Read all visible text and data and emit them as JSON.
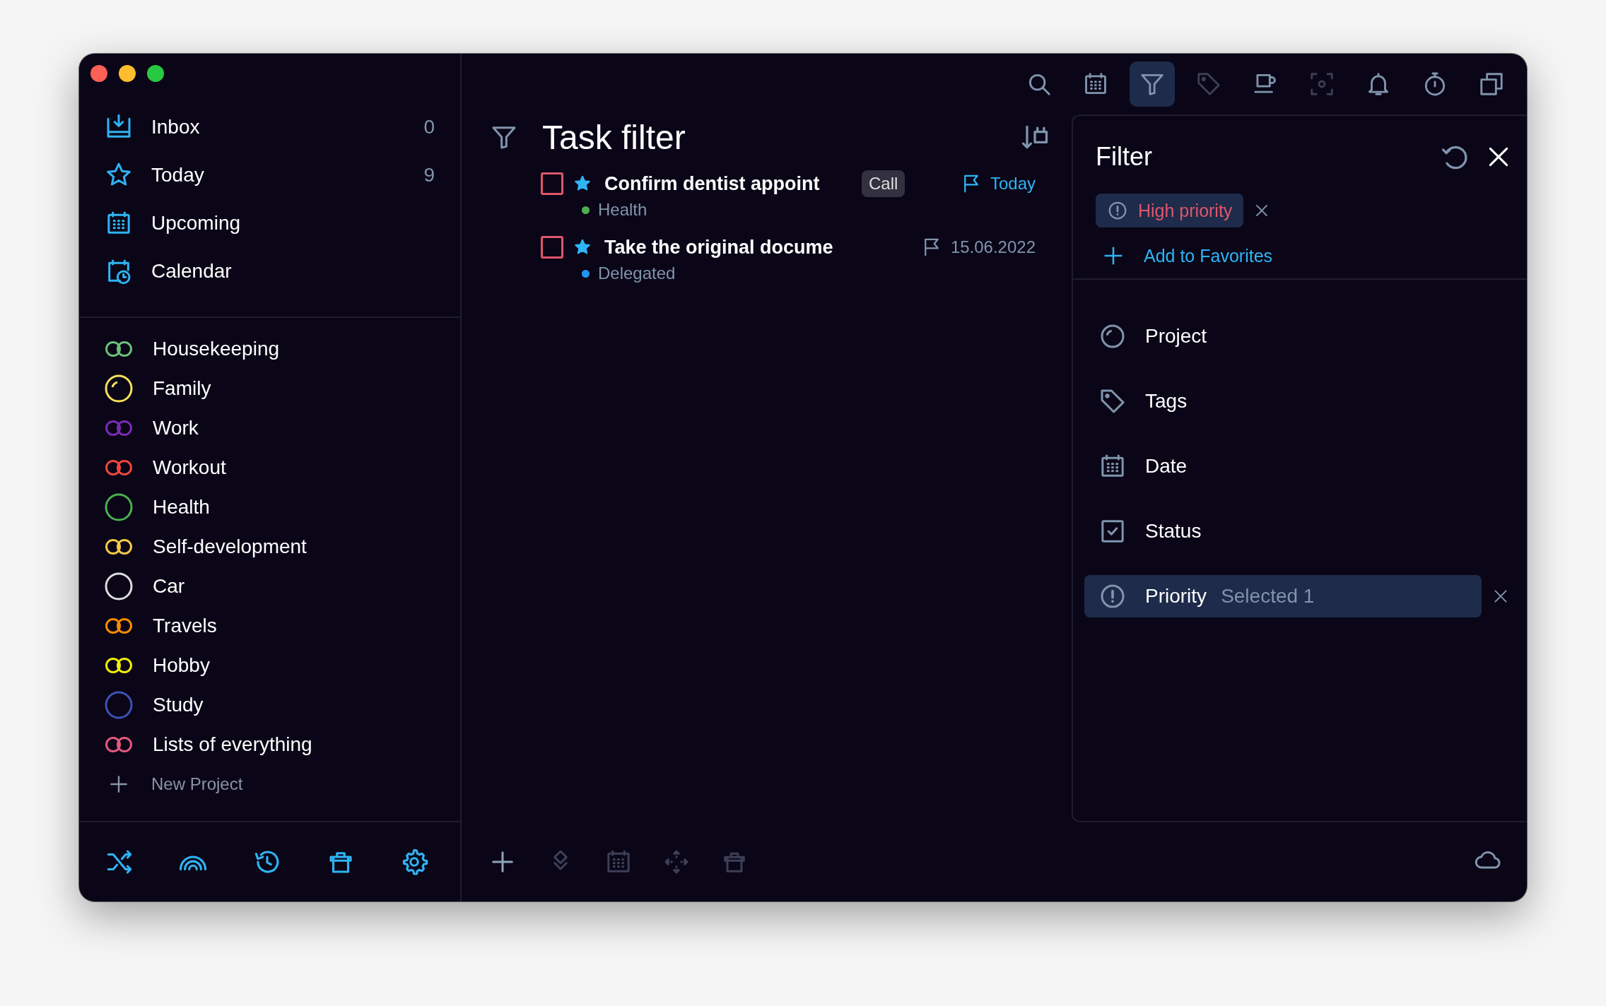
{
  "sidebar": {
    "nav": [
      {
        "kind": "inbox",
        "label": "Inbox",
        "count": "0"
      },
      {
        "kind": "today",
        "label": "Today",
        "count": "9"
      },
      {
        "kind": "upcoming",
        "label": "Upcoming"
      },
      {
        "kind": "calendar",
        "label": "Calendar"
      }
    ],
    "projects": [
      {
        "label": "Housekeeping",
        "kind": "linked",
        "color": "#6cc17a"
      },
      {
        "label": "Family",
        "kind": "partial",
        "color": "#f5e15a"
      },
      {
        "label": "Work",
        "kind": "linked",
        "color": "#7a2bb8"
      },
      {
        "label": "Workout",
        "kind": "linked",
        "color": "#f0473c"
      },
      {
        "label": "Health",
        "kind": "ring",
        "color": "#4caf50"
      },
      {
        "label": "Self-development",
        "kind": "linked",
        "color": "#f7c948"
      },
      {
        "label": "Car",
        "kind": "ring",
        "color": "#dddddd"
      },
      {
        "label": "Travels",
        "kind": "linked",
        "color": "#ff8c00"
      },
      {
        "label": "Hobby",
        "kind": "linked",
        "color": "#f4f000"
      },
      {
        "label": "Study",
        "kind": "ring",
        "color": "#3f51b5"
      },
      {
        "label": "Lists of everything",
        "kind": "linked",
        "color": "#e5587f"
      }
    ],
    "new_project": "New Project",
    "bottom_bar": [
      {
        "kind": "shuffle"
      },
      {
        "kind": "rainbow"
      },
      {
        "kind": "history"
      },
      {
        "kind": "trash"
      },
      {
        "kind": "settings"
      }
    ]
  },
  "toolbar": [
    {
      "kind": "search",
      "selected": false,
      "disabled": false
    },
    {
      "kind": "calendar-grid",
      "selected": false,
      "disabled": false
    },
    {
      "kind": "filter",
      "selected": true,
      "disabled": false
    },
    {
      "kind": "tag",
      "selected": false,
      "disabled": true
    },
    {
      "kind": "cup",
      "selected": false,
      "disabled": false
    },
    {
      "kind": "focus",
      "selected": false,
      "disabled": true
    },
    {
      "kind": "bell",
      "selected": false,
      "disabled": false
    },
    {
      "kind": "timer",
      "selected": false,
      "disabled": false
    },
    {
      "kind": "copy",
      "selected": false,
      "disabled": false
    }
  ],
  "main": {
    "title": "Task filter",
    "tasks": [
      {
        "title": "Confirm dentist appoint",
        "checked": false,
        "starred": true,
        "tag": "Call",
        "date": "Today",
        "due_today": true,
        "project": {
          "label": "Health",
          "color": "#4caf50"
        }
      },
      {
        "title": "Take the original docume",
        "checked": false,
        "starred": true,
        "date": "15.06.2022",
        "due_today": false,
        "project": {
          "label": "Delegated",
          "color": "#2196f3"
        }
      }
    ],
    "bottom_bar": [
      {
        "kind": "add",
        "disabled": false
      },
      {
        "kind": "layers",
        "disabled": true
      },
      {
        "kind": "calendar-grid",
        "disabled": true
      },
      {
        "kind": "move",
        "disabled": true
      },
      {
        "kind": "trash",
        "disabled": true
      }
    ]
  },
  "filter": {
    "title": "Filter",
    "chips": [
      {
        "label": "High priority"
      }
    ],
    "add_favorites": "Add to Favorites",
    "rows": [
      {
        "kind": "project",
        "label": "Project",
        "selected": false
      },
      {
        "kind": "tags",
        "label": "Tags",
        "selected": false
      },
      {
        "kind": "date",
        "label": "Date",
        "selected": false
      },
      {
        "kind": "status",
        "label": "Status",
        "selected": false
      },
      {
        "kind": "priority",
        "label": "Priority",
        "selected": true,
        "value": "Selected 1"
      }
    ]
  }
}
